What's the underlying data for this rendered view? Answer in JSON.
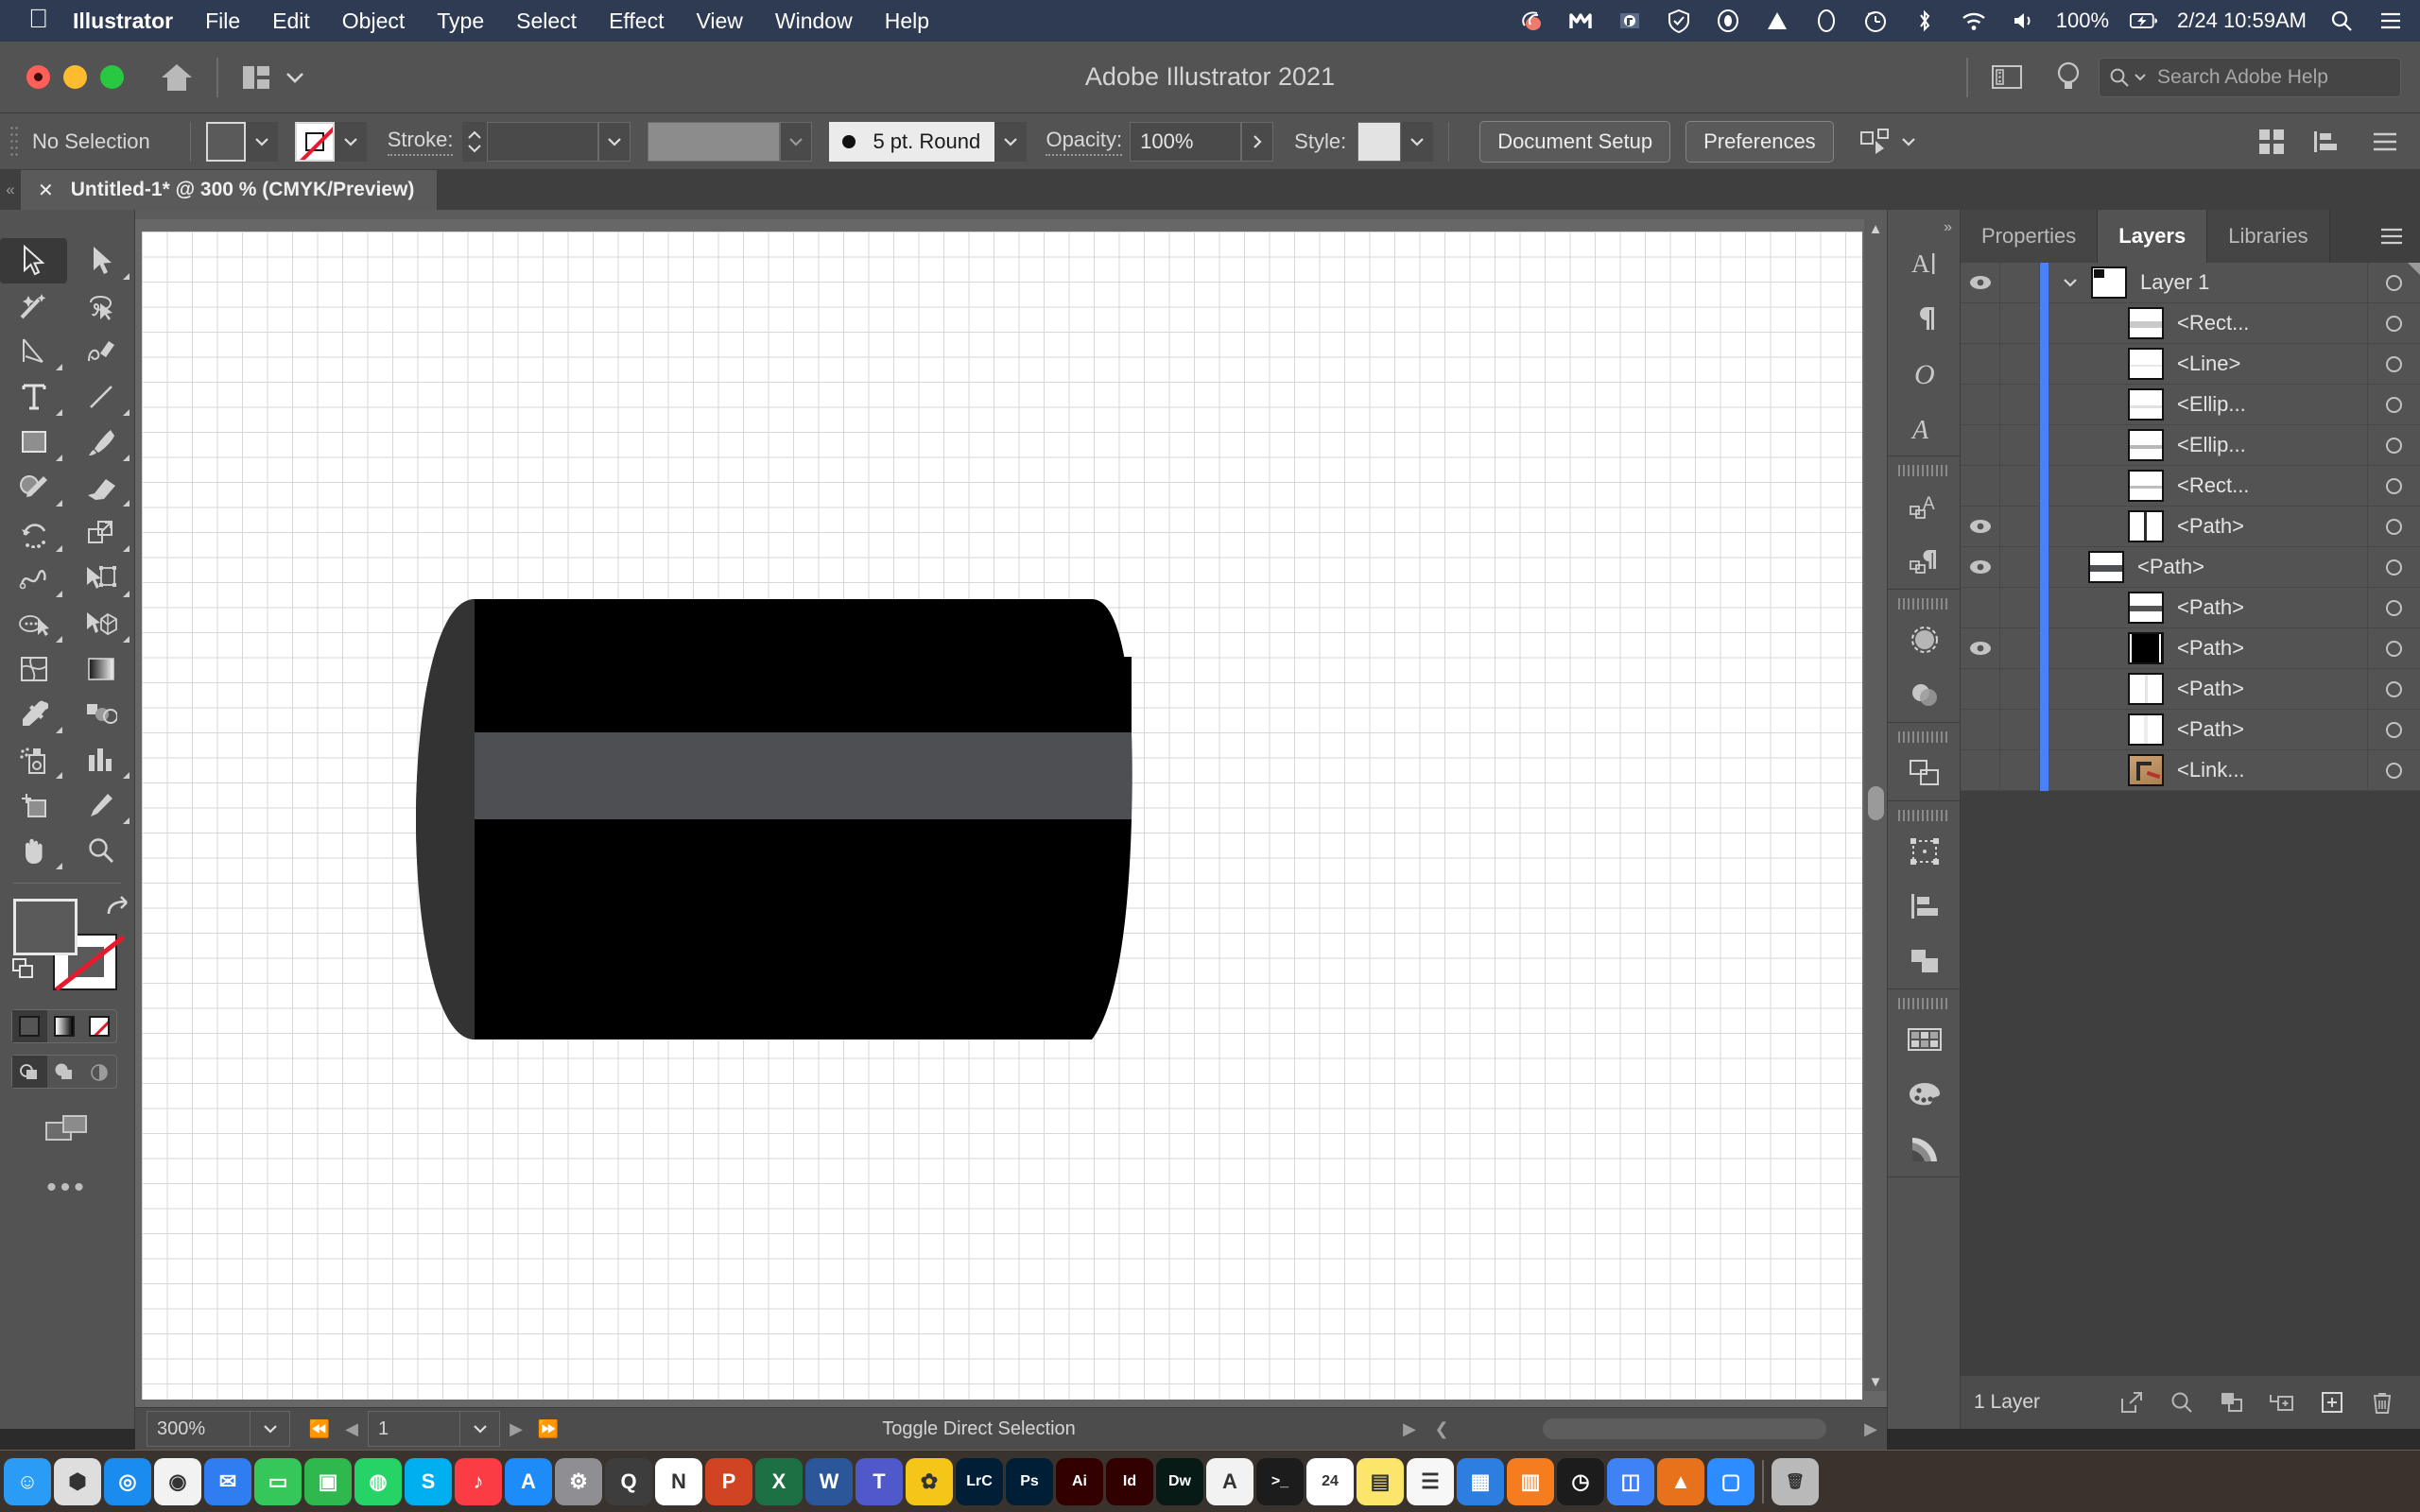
{
  "menubar": {
    "apple_icon": "apple-logo-icon",
    "items": [
      {
        "label": "Illustrator",
        "bold": true
      },
      {
        "label": "File",
        "bold": false
      },
      {
        "label": "Edit",
        "bold": false
      },
      {
        "label": "Object",
        "bold": false
      },
      {
        "label": "Type",
        "bold": false
      },
      {
        "label": "Select",
        "bold": false
      },
      {
        "label": "Effect",
        "bold": false
      },
      {
        "label": "View",
        "bold": false
      },
      {
        "label": "Window",
        "bold": false
      },
      {
        "label": "Help",
        "bold": false
      }
    ],
    "status_icons": [
      "grammarly-icon",
      "malwarebytes-icon",
      "dropbox-icon",
      "shield-check-icon",
      "record-icon",
      "triangle-icon",
      "ellipse-icon",
      "time-machine-icon",
      "bluetooth-icon",
      "wifi-icon",
      "volume-icon"
    ],
    "battery_percent": "100%",
    "battery_icon": "battery-charging-icon",
    "datetime": "2/24 10:59AM",
    "spotlight_icon": "search-icon",
    "controlcenter_icon": "control-center-icon"
  },
  "titlebar": {
    "title": "Adobe Illustrator 2021",
    "home_icon": "home-icon",
    "arrange_icon": "arrange-documents-icon",
    "arrange_chevron": "chevron-down-icon",
    "workspace_icon": "workspace-switcher-icon",
    "tips_icon": "lightbulb-icon",
    "search_icon": "search-icon",
    "search_chevron": "chevron-down-icon",
    "search_placeholder": "Search Adobe Help"
  },
  "controlbar": {
    "selection_status": "No Selection",
    "fill_label": "fill-swatch",
    "stroke_swatch_label": "stroke-none-swatch",
    "stroke_label": "Stroke:",
    "stroke_weight_value": "",
    "stroke_profile_value": "",
    "brush_definition": "5 pt. Round",
    "opacity_label": "Opacity:",
    "opacity_value": "100%",
    "style_label": "Style:",
    "document_setup": "Document Setup",
    "preferences": "Preferences",
    "select_similar_icon": "select-similar-options-icon",
    "arrange_grid_icon": "arrange-grid-icon",
    "align_icon": "align-icon",
    "menu_icon": "panel-menu-icon"
  },
  "tabstrip": {
    "close_icon": "close-icon",
    "document_tab": "Untitled-1* @ 300 % (CMYK/Preview)"
  },
  "tools": [
    {
      "name": "selection-tool",
      "selected": true,
      "corner": false
    },
    {
      "name": "direct-selection-tool",
      "selected": false,
      "corner": true
    },
    {
      "name": "magic-wand-tool",
      "selected": false,
      "corner": false
    },
    {
      "name": "lasso-tool",
      "selected": false,
      "corner": false
    },
    {
      "name": "pen-tool",
      "selected": false,
      "corner": true
    },
    {
      "name": "curvature-tool",
      "selected": false,
      "corner": false
    },
    {
      "name": "type-tool",
      "selected": false,
      "corner": true
    },
    {
      "name": "line-segment-tool",
      "selected": false,
      "corner": true
    },
    {
      "name": "rectangle-tool",
      "selected": false,
      "corner": true
    },
    {
      "name": "paintbrush-tool",
      "selected": false,
      "corner": true
    },
    {
      "name": "shaper-pencil-tool",
      "selected": false,
      "corner": true
    },
    {
      "name": "eraser-tool",
      "selected": false,
      "corner": true
    },
    {
      "name": "rotate-tool",
      "selected": false,
      "corner": true
    },
    {
      "name": "scale-tool",
      "selected": false,
      "corner": true
    },
    {
      "name": "width-tool",
      "selected": false,
      "corner": true
    },
    {
      "name": "free-transform-tool",
      "selected": false,
      "corner": true
    },
    {
      "name": "shape-builder-tool",
      "selected": false,
      "corner": true
    },
    {
      "name": "perspective-grid-tool",
      "selected": false,
      "corner": true
    },
    {
      "name": "mesh-tool",
      "selected": false,
      "corner": false
    },
    {
      "name": "gradient-tool",
      "selected": false,
      "corner": false
    },
    {
      "name": "eyedropper-tool",
      "selected": false,
      "corner": true
    },
    {
      "name": "blend-tool",
      "selected": false,
      "corner": false
    },
    {
      "name": "symbol-sprayer-tool",
      "selected": false,
      "corner": true
    },
    {
      "name": "column-graph-tool",
      "selected": false,
      "corner": true
    },
    {
      "name": "artboard-tool",
      "selected": false,
      "corner": false
    },
    {
      "name": "slice-tool",
      "selected": false,
      "corner": true
    },
    {
      "name": "hand-tool",
      "selected": false,
      "corner": true
    },
    {
      "name": "zoom-tool",
      "selected": false,
      "corner": false
    }
  ],
  "toolbar_bottom": {
    "fill_swatch": "fill-color-swatch",
    "stroke_swatch": "stroke-color-swatch",
    "swap_icon": "swap-fill-stroke-icon",
    "default_icon": "default-fill-stroke-icon",
    "color_mode": "color-swatch-button",
    "gradient_mode": "gradient-button",
    "none_mode": "none-button",
    "draw_normal": "draw-normal-icon",
    "draw_behind": "draw-behind-icon",
    "draw_inside": "draw-inside-icon",
    "screen_mode": "change-screen-mode-icon",
    "more_icon": "edit-toolbar-icon"
  },
  "canvas": {
    "artwork_name": "cylinder-artwork",
    "colors": {
      "body": "#000000",
      "band": "#4d4f52",
      "left_cap": "#333333"
    }
  },
  "statusbar": {
    "zoom_value": "300%",
    "zoom_chevron": "chevron-down-icon",
    "first_page_icon": "first-artboard-icon",
    "prev_page_icon": "previous-artboard-icon",
    "page_value": "1",
    "page_chevron": "chevron-down-icon",
    "next_page_icon": "next-artboard-icon",
    "last_page_icon": "last-artboard-icon",
    "status_text": "Toggle Direct Selection",
    "status_arrow": "play-arrow-icon",
    "resize_icon": "resize-grip-icon"
  },
  "icondock": [
    {
      "name": "character-panel-icon",
      "group": 0
    },
    {
      "name": "paragraph-panel-icon",
      "group": 0
    },
    {
      "name": "opentype-panel-icon",
      "group": 0
    },
    {
      "name": "glyphs-panel-icon",
      "group": 0
    },
    {
      "name": "character-styles-panel-icon",
      "group": 1
    },
    {
      "name": "paragraph-styles-panel-icon",
      "group": 1
    },
    {
      "name": "appearance-panel-icon",
      "group": 2
    },
    {
      "name": "transparency-panel-icon",
      "group": 2
    },
    {
      "name": "pathfinder-panel-icon",
      "group": 3
    },
    {
      "name": "transform-panel-icon",
      "group": 4
    },
    {
      "name": "align-panel-icon",
      "group": 4
    },
    {
      "name": "layers-panel-icon",
      "group": 4
    },
    {
      "name": "swatches-panel-icon",
      "group": 5
    },
    {
      "name": "color-panel-icon",
      "group": 5
    },
    {
      "name": "color-guide-panel-icon",
      "group": 5
    }
  ],
  "panel": {
    "tabs": [
      {
        "label": "Properties",
        "active": false
      },
      {
        "label": "Layers",
        "active": true
      },
      {
        "label": "Libraries",
        "active": false
      }
    ],
    "menu_icon": "panel-menu-icon",
    "layers": [
      {
        "name": "Layer 1",
        "visible": true,
        "top": true,
        "disclosure": "chevron-down-icon",
        "thumb": "layer-thumb"
      },
      {
        "name": "<Rect...",
        "visible": false,
        "top": false,
        "thumb": "rect-thumb"
      },
      {
        "name": "<Line>",
        "visible": false,
        "top": false,
        "thumb": "line-thumb"
      },
      {
        "name": "<Ellip...",
        "visible": false,
        "top": false,
        "thumb": "ellipse-thumb"
      },
      {
        "name": "<Ellip...",
        "visible": false,
        "top": false,
        "thumb": "ellipse-thumb"
      },
      {
        "name": "<Rect...",
        "visible": false,
        "top": false,
        "thumb": "rect-thumb"
      },
      {
        "name": "<Path>",
        "visible": true,
        "top": false,
        "thumb": "path-vert-thumb"
      },
      {
        "name": "<Path>",
        "visible": true,
        "top": false,
        "thumb": "path-band-thumb"
      },
      {
        "name": "<Path>",
        "visible": false,
        "top": false,
        "thumb": "path-band-thumb"
      },
      {
        "name": "<Path>",
        "visible": true,
        "top": false,
        "thumb": "path-black-thumb"
      },
      {
        "name": "<Path>",
        "visible": false,
        "top": false,
        "thumb": "path-light-thumb"
      },
      {
        "name": "<Path>",
        "visible": false,
        "top": false,
        "thumb": "path-light-thumb"
      },
      {
        "name": "<Link...",
        "visible": false,
        "top": false,
        "thumb": "linked-image-thumb"
      }
    ],
    "footer": {
      "layer_count": "1 Layer",
      "locate_icon": "locate-object-icon",
      "find_icon": "search-icon",
      "collect_icon": "collect-for-export-icon",
      "sublayer_icon": "new-sublayer-icon",
      "newlayer_icon": "new-layer-icon",
      "delete_icon": "delete-layer-icon"
    }
  },
  "dock": {
    "apps": [
      {
        "name": "finder-icon",
        "color": "#2a9cf5",
        "glyph": "☺"
      },
      {
        "name": "launchpad-icon",
        "color": "#dedede",
        "glyph": "⬢"
      },
      {
        "name": "safari-icon",
        "color": "#1a8cf0",
        "glyph": "◎"
      },
      {
        "name": "chrome-icon",
        "color": "#f2f2f2",
        "glyph": "◉"
      },
      {
        "name": "mail-icon",
        "color": "#2f7df0",
        "glyph": "✉"
      },
      {
        "name": "messages-icon",
        "color": "#35c759",
        "glyph": "▭"
      },
      {
        "name": "facetime-icon",
        "color": "#2eb84e",
        "glyph": "▣"
      },
      {
        "name": "whatsapp-icon",
        "color": "#25d366",
        "glyph": "◍"
      },
      {
        "name": "skype-icon",
        "color": "#00aff0",
        "glyph": "S"
      },
      {
        "name": "music-icon",
        "color": "#fc3c44",
        "glyph": "♪"
      },
      {
        "name": "appstore-icon",
        "color": "#1d8cf8",
        "glyph": "A"
      },
      {
        "name": "system-preferences-icon",
        "color": "#8e8e93",
        "glyph": "⚙"
      },
      {
        "name": "qbittorrent-icon",
        "color": "#3d3d3d",
        "glyph": "Q"
      },
      {
        "name": "notion-icon",
        "color": "#ffffff",
        "glyph": "N"
      },
      {
        "name": "powerpoint-icon",
        "color": "#d04423",
        "glyph": "P"
      },
      {
        "name": "excel-icon",
        "color": "#1d7044",
        "glyph": "X"
      },
      {
        "name": "word-icon",
        "color": "#2b579a",
        "glyph": "W"
      },
      {
        "name": "teams-icon",
        "color": "#5059c9",
        "glyph": "T"
      },
      {
        "name": "photos-icon",
        "color": "#f5c518",
        "glyph": "✿"
      },
      {
        "name": "lightroom-classic-icon",
        "color": "#001e36",
        "glyph": "LrC"
      },
      {
        "name": "photoshop-icon",
        "color": "#001e36",
        "glyph": "Ps"
      },
      {
        "name": "illustrator-icon",
        "color": "#330000",
        "glyph": "Ai"
      },
      {
        "name": "indesign-icon",
        "color": "#310000",
        "glyph": "Id"
      },
      {
        "name": "dreamweaver-icon",
        "color": "#071a16",
        "glyph": "Dw"
      },
      {
        "name": "acrobat-icon",
        "color": "#f2f2f2",
        "glyph": "A"
      },
      {
        "name": "terminal-icon",
        "color": "#1c1c1c",
        "glyph": ">_"
      },
      {
        "name": "calendar-icon",
        "color": "#ffffff",
        "glyph": "24"
      },
      {
        "name": "notes-icon",
        "color": "#fbe66b",
        "glyph": "▤"
      },
      {
        "name": "reminders-icon",
        "color": "#f7f7f7",
        "glyph": "☰"
      },
      {
        "name": "keynote-icon",
        "color": "#2c7fe0",
        "glyph": "▦"
      },
      {
        "name": "books-icon",
        "color": "#f57c1f",
        "glyph": "▥"
      },
      {
        "name": "clock-icon",
        "color": "#1c1c1c",
        "glyph": "◷"
      },
      {
        "name": "preview-icon",
        "color": "#3f82f5",
        "glyph": "◫"
      },
      {
        "name": "vlc-icon",
        "color": "#e8721c",
        "glyph": "▲"
      },
      {
        "name": "zoom-app-icon",
        "color": "#2d8cff",
        "glyph": "▢"
      },
      {
        "name": "trash-icon",
        "color": "#b9b9b9",
        "glyph": "🗑"
      }
    ]
  }
}
